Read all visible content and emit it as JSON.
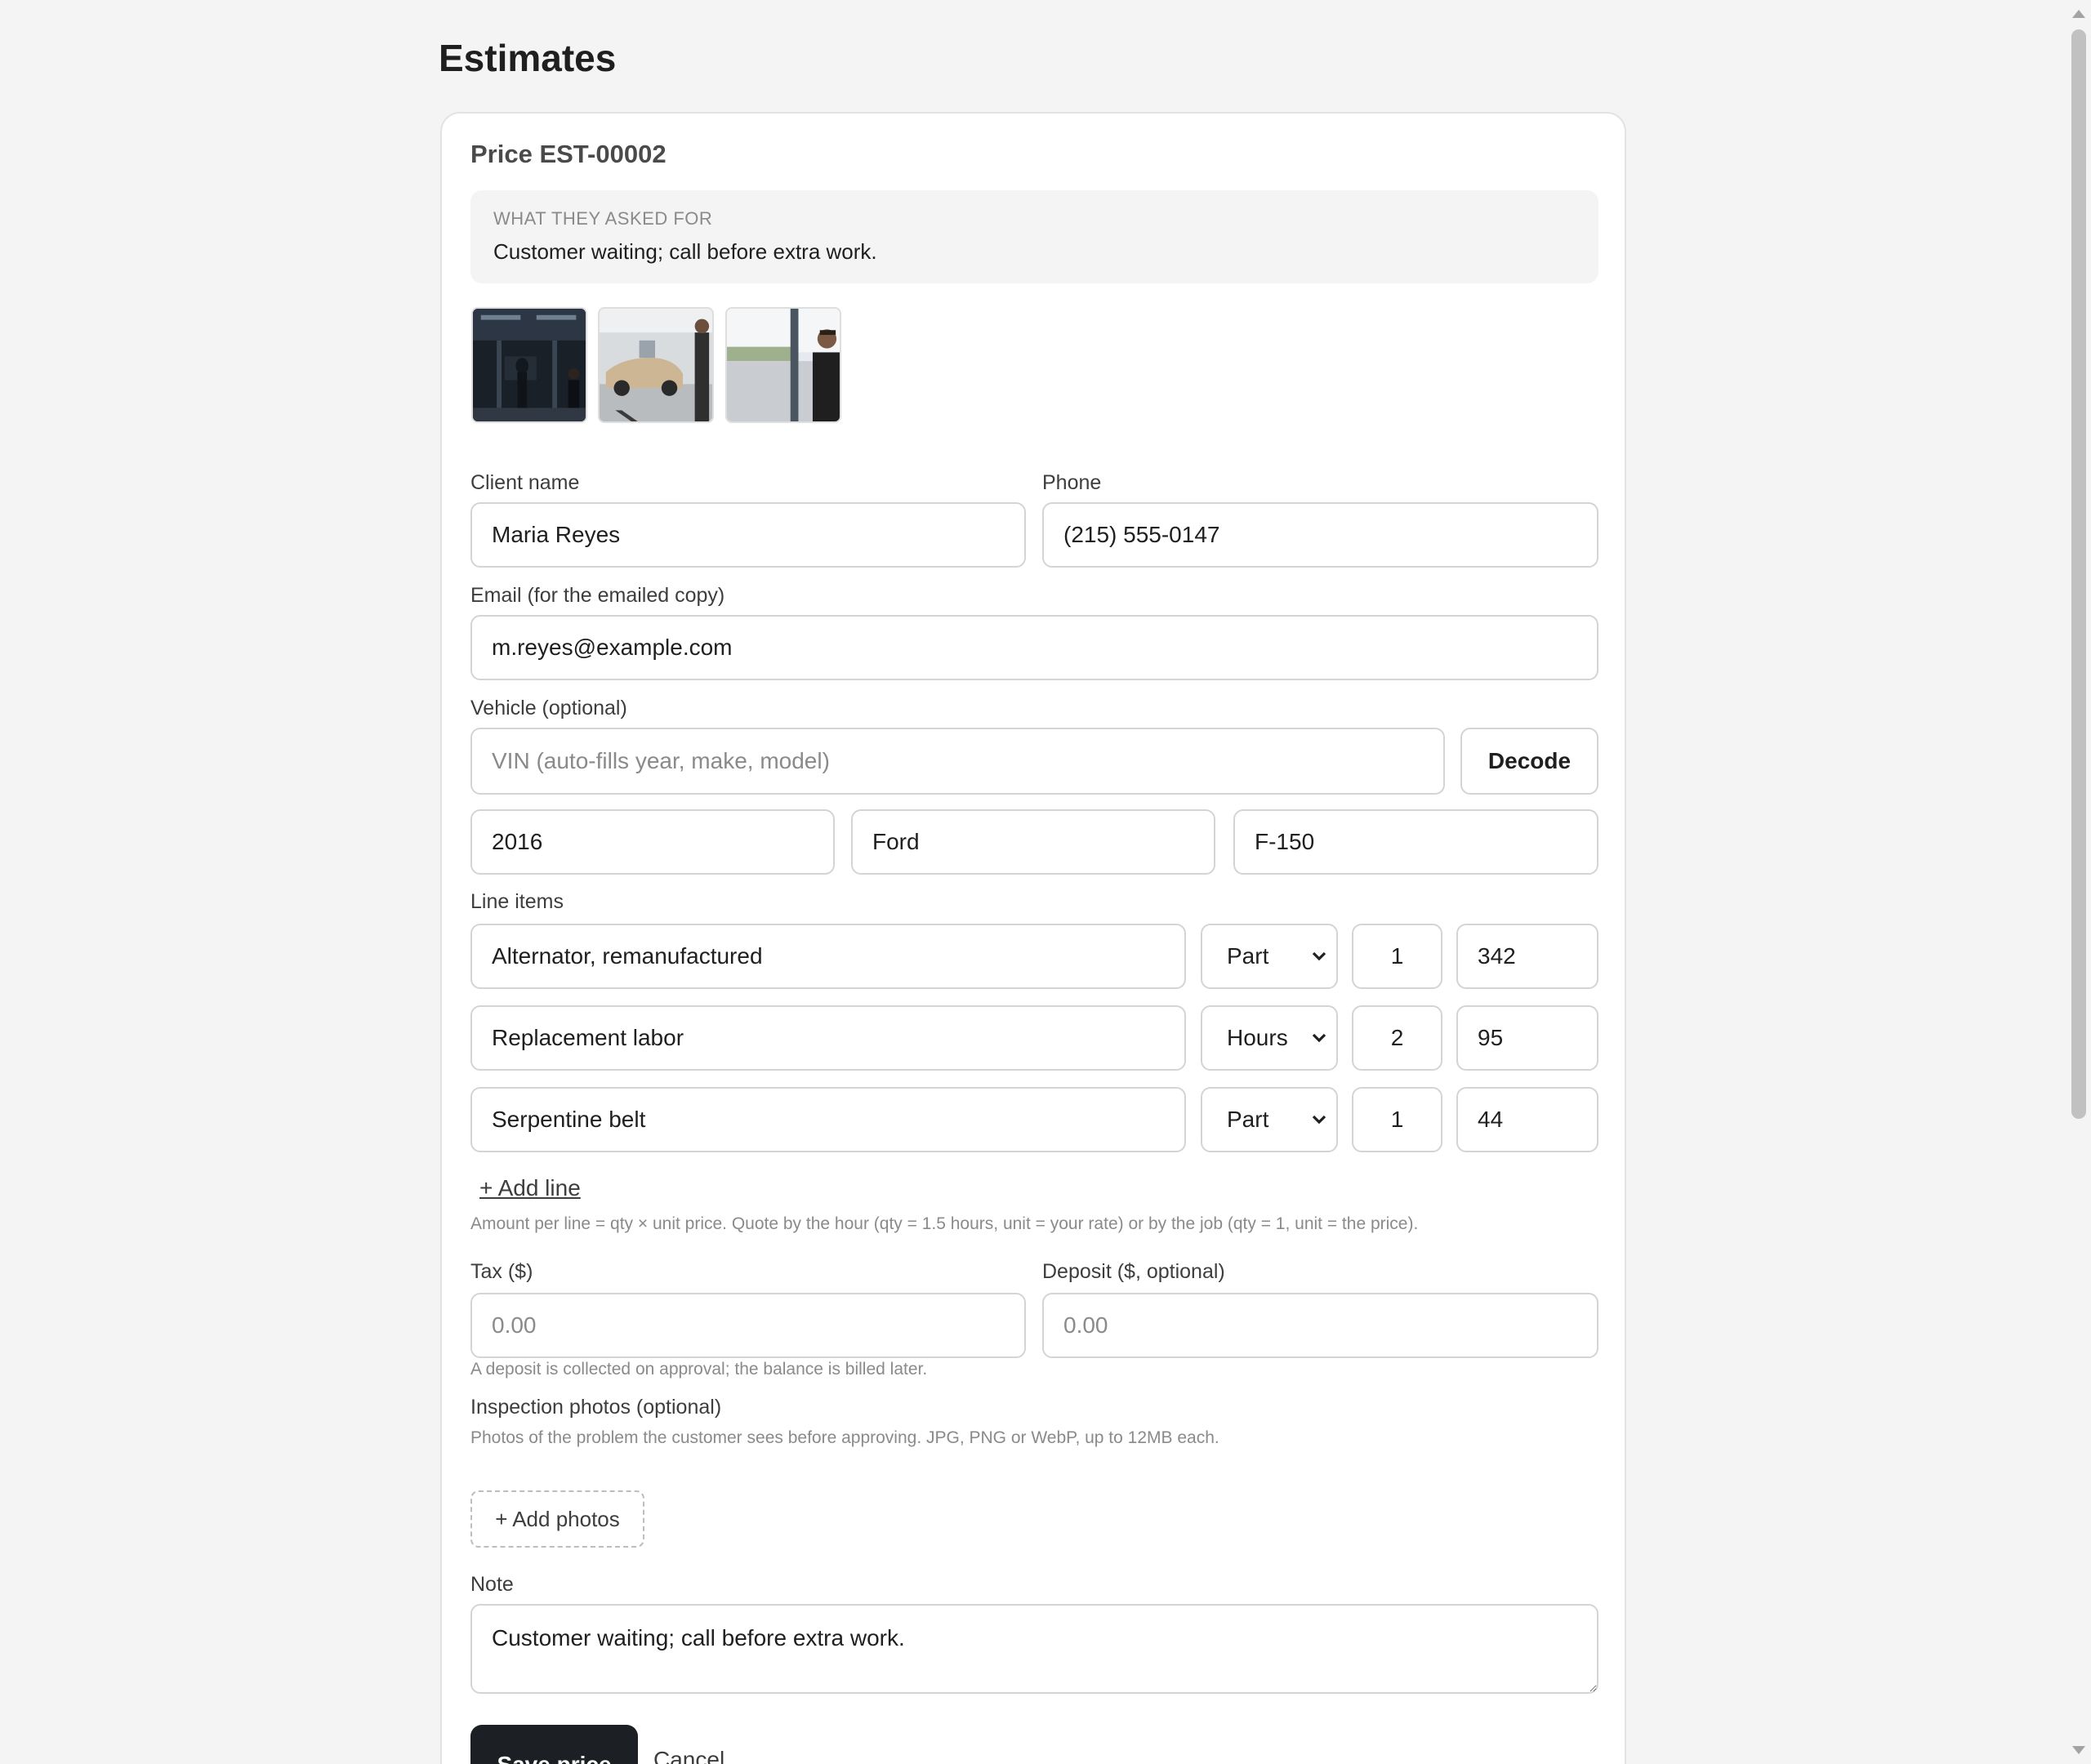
{
  "page": {
    "title": "Estimates"
  },
  "estimate": {
    "title": "Price EST-00002",
    "asked": {
      "label": "WHAT THEY ASKED FOR",
      "text": "Customer waiting; call before extra work."
    },
    "photos": [
      "shop-photo-1",
      "shop-photo-2",
      "shop-photo-3"
    ]
  },
  "client": {
    "name_label": "Client name",
    "name_value": "Maria Reyes",
    "phone_label": "Phone",
    "phone_value": "(215) 555-0147",
    "email_label": "Email (for the emailed copy)",
    "email_value": "m.reyes@example.com"
  },
  "vehicle": {
    "label": "Vehicle (optional)",
    "vin_placeholder": "VIN (auto-fills year, make, model)",
    "decode_label": "Decode",
    "year": "2016",
    "make": "Ford",
    "model": "F-150"
  },
  "line_items": {
    "label": "Line items",
    "rows": [
      {
        "description": "Alternator, remanufactured",
        "type": "Part",
        "qty": "1",
        "unit": "342"
      },
      {
        "description": "Replacement labor",
        "type": "Hours",
        "qty": "2",
        "unit": "95"
      },
      {
        "description": "Serpentine belt",
        "type": "Part",
        "qty": "1",
        "unit": "44"
      }
    ],
    "add_line_label": "+ Add line",
    "hint": "Amount per line = qty × unit price. Quote by the hour (qty = 1.5 hours, unit = your rate) or by the job (qty = 1, unit = the price)."
  },
  "tax": {
    "label": "Tax ($)",
    "placeholder": "0.00"
  },
  "deposit": {
    "label": "Deposit ($, optional)",
    "placeholder": "0.00",
    "hint": "A deposit is collected on approval; the balance is billed later."
  },
  "inspection": {
    "label": "Inspection photos (optional)",
    "hint": "Photos of the problem the customer sees before approving. JPG, PNG or WebP, up to 12MB each.",
    "add_label": "+ Add photos"
  },
  "note": {
    "label": "Note",
    "value": "Customer waiting; call before extra work."
  },
  "actions": {
    "save_label": "Save price",
    "cancel_label": "Cancel"
  }
}
